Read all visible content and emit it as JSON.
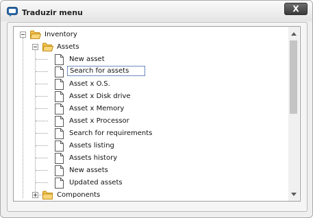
{
  "window": {
    "title": "Traduzir menu",
    "close_label": "X"
  },
  "tree": {
    "root_label": "Inventory",
    "assets_label": "Assets",
    "editing_value": "Search for assets",
    "children": [
      "New asset",
      "Asset x O.S.",
      "Asset x Disk drive",
      "Asset x Memory",
      "Asset x Processor",
      "Search for requirements",
      "Assets listing",
      "Assets history",
      "New assets",
      "Updated assets"
    ],
    "components_label": "Components"
  },
  "colors": {
    "folder": "#f3c14b",
    "folder_dark": "#d9a021",
    "close_button": "#4a4a4a",
    "edit_border": "#6a89c0"
  }
}
